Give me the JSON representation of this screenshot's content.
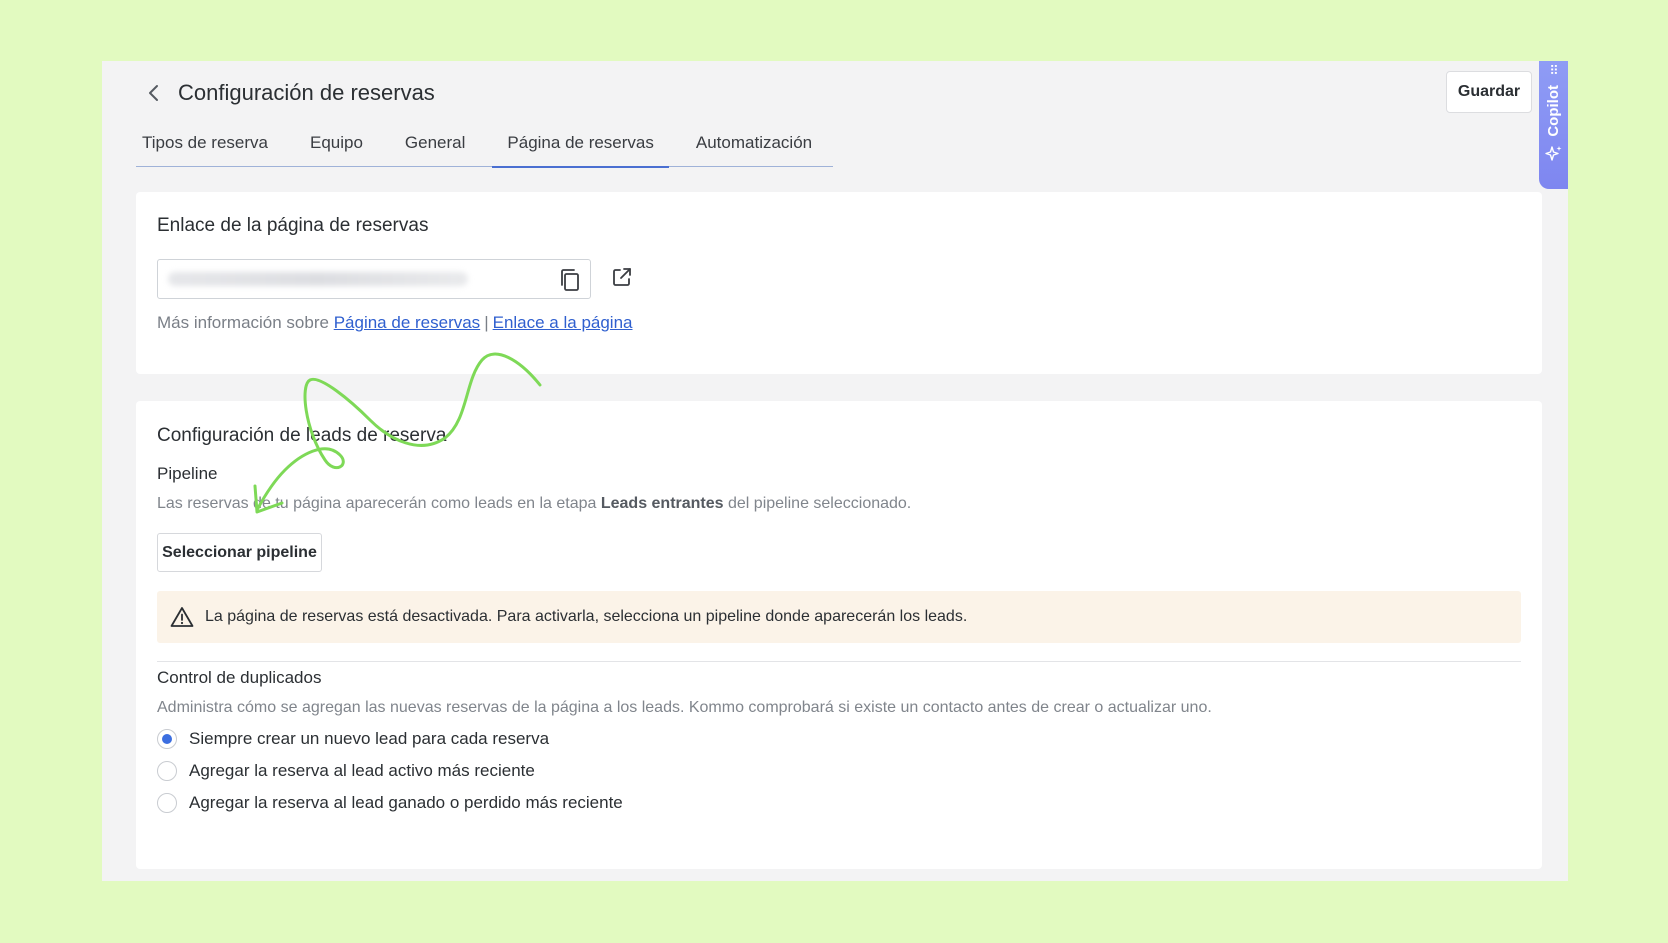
{
  "header": {
    "title": "Configuración de reservas",
    "save_label": "Guardar"
  },
  "tabs": [
    {
      "label": "Tipos de reserva",
      "active": false
    },
    {
      "label": "Equipo",
      "active": false
    },
    {
      "label": "General",
      "active": false
    },
    {
      "label": "Página de reservas",
      "active": true
    },
    {
      "label": "Automatización",
      "active": false
    }
  ],
  "copilot": {
    "label": "Copilot",
    "grip": "⠿"
  },
  "link_section": {
    "title": "Enlace de la página de reservas",
    "more_info_prefix": "Más información sobre",
    "link1": "Página de reservas",
    "separator": "|",
    "link2": "Enlace a la página"
  },
  "leads_section": {
    "title": "Configuración de leads de reserva",
    "pipeline_label": "Pipeline",
    "pipeline_desc_before": "Las reservas de tu página aparecerán como leads en la etapa ",
    "pipeline_desc_bold": "Leads entrantes",
    "pipeline_desc_after": " del pipeline seleccionado.",
    "select_button": "Seleccionar pipeline",
    "warning": "La página de reservas está desactivada. Para activarla, selecciona un pipeline donde aparecerán los leads.",
    "duplicates_label": "Control de duplicados",
    "duplicates_desc": "Administra cómo se agregan las nuevas reservas de la página a los leads. Kommo comprobará si existe un contacto antes de crear o actualizar uno.",
    "options": [
      {
        "label": "Siempre crear un nuevo lead para cada reserva",
        "checked": true
      },
      {
        "label": "Agregar la reserva al lead activo más reciente",
        "checked": false
      },
      {
        "label": "Agregar la reserva al lead ganado o perdido más reciente",
        "checked": false
      }
    ]
  },
  "colors": {
    "background": "#e2fac0",
    "accent": "#3b6ee0",
    "link": "#2f5fcf",
    "copilot": "#8f9cf5",
    "warning_bg": "#fbf3e8",
    "annotation": "#7ed957"
  }
}
